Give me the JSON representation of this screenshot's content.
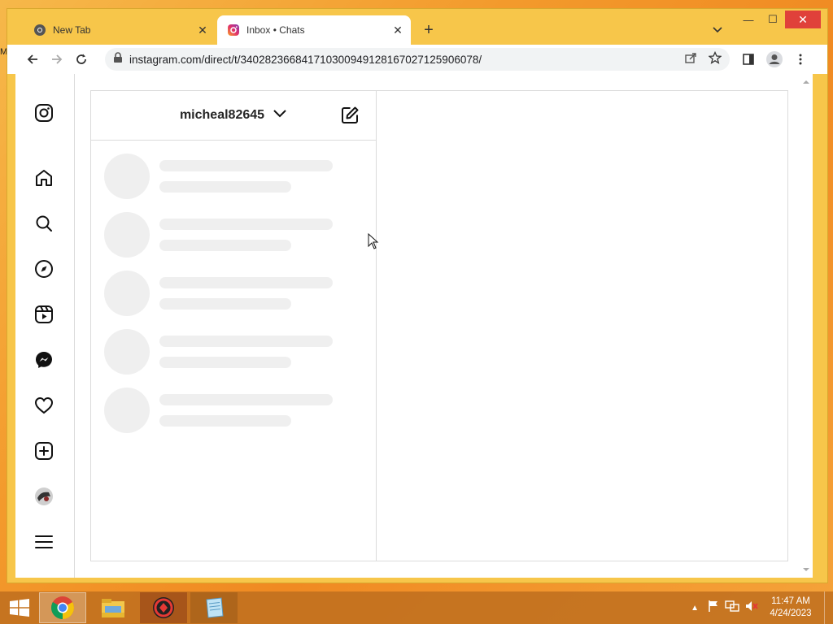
{
  "browser": {
    "tabs": [
      {
        "label": "New Tab",
        "active": false,
        "icon": "chrome-icon"
      },
      {
        "label": "Inbox • Chats",
        "active": true,
        "icon": "instagram-icon"
      }
    ],
    "url": "instagram.com/direct/t/340282366841710300949128167027125906078/"
  },
  "instagram": {
    "account": "micheal82645",
    "nav_icons": [
      "instagram-logo-icon",
      "home-icon",
      "search-icon",
      "explore-icon",
      "reels-icon",
      "messenger-icon",
      "heart-icon",
      "create-icon",
      "profile-avatar",
      "menu-icon"
    ],
    "skeleton_rows": 5
  },
  "taskbar": {
    "time": "11:47 AM",
    "date": "4/24/2023",
    "apps": [
      "chrome-icon",
      "file-explorer-icon",
      "app-red-icon",
      "notepad-icon"
    ]
  },
  "colors": {
    "window_frame": "#f7c64a",
    "close_red": "#e0413a",
    "skeleton": "#efefef",
    "border": "#dbdbdb"
  }
}
